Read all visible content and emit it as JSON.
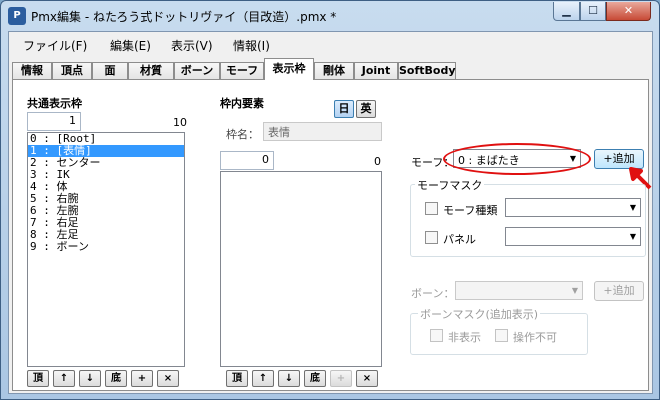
{
  "window": {
    "title": "Pmx編集 - ねたろう式ドットリヴァイ（目改造）.pmx *",
    "app_icon_text": "P"
  },
  "menu": [
    "ファイル(F)",
    "編集(E)",
    "表示(V)",
    "情報(I)"
  ],
  "tabs": [
    "情報",
    "頂点",
    "面",
    "材質",
    "ボーン",
    "モーフ",
    "表示枠",
    "剛体",
    "Joint",
    "SoftBody"
  ],
  "active_tab": "表示枠",
  "common_frames": {
    "label": "共通表示枠",
    "index_value": "1",
    "count": "10",
    "items": [
      "0 : [Root]",
      "1 : [表情]",
      "2 : センター",
      "3 : IK",
      "4 : 体",
      "5 : 右腕",
      "6 : 左腕",
      "7 : 右足",
      "8 : 左足",
      "9 : ボーン"
    ],
    "selected_index": 1
  },
  "frame_elements": {
    "label": "枠内要素",
    "lang_jp": "日",
    "lang_en": "英",
    "frame_name_label": "枠名：",
    "frame_name_value": "表情",
    "index_value": "0",
    "count": "0"
  },
  "list_buttons": [
    "頂",
    "↑",
    "↓",
    "底",
    "+",
    "×"
  ],
  "morph": {
    "label": "モーフ：",
    "selected": "0 : まばたき",
    "add_button": "+追加",
    "mask_title": "モーフマスク",
    "type_label": "モーフ種類",
    "panel_label": "パネル"
  },
  "bone": {
    "label": "ボーン：",
    "add_button": "+追加",
    "mask_title": "ボーンマスク(追加表示)",
    "hide_label": "非表示",
    "no_operate_label": "操作不可"
  },
  "colors": {
    "selection": "#3399ff",
    "annotation": "#e01010"
  }
}
